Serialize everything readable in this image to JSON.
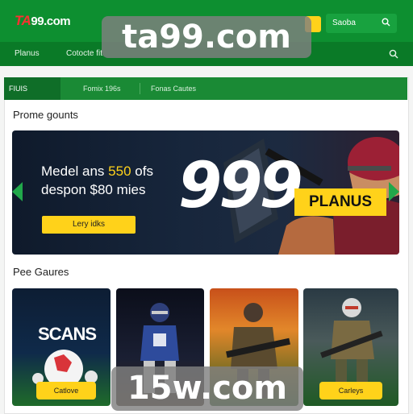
{
  "header": {
    "logo_mark": "TA",
    "logo_rest": "99.com",
    "search_label": "Saoba",
    "search_icon": "search-icon"
  },
  "nav": {
    "items": [
      "Planus",
      "Cotocte fit"
    ]
  },
  "watermarks": {
    "top": "ta99.com",
    "bottom": "15w.com"
  },
  "tabs": [
    "FIUIS",
    "Fomix 196s",
    "Fonas Cautes"
  ],
  "promo": {
    "title": "Prome gounts",
    "line1_prefix": "Medel ans ",
    "line1_highlight": "550",
    "line1_suffix": " ofs",
    "line2": "despon $80 mies",
    "cta": "Lery idks",
    "big_text": "999",
    "badge": "PLANUS"
  },
  "games": {
    "title": "Pee Gaures",
    "tile1_title": "SCANS",
    "tile1_button": "Catlove",
    "tile4_button": "Carleys"
  },
  "colors": {
    "brand_green": "#0d8f30",
    "nav_green": "#0a7a27",
    "accent_yellow": "#ffd21a",
    "banner_dark": "#17263c"
  }
}
